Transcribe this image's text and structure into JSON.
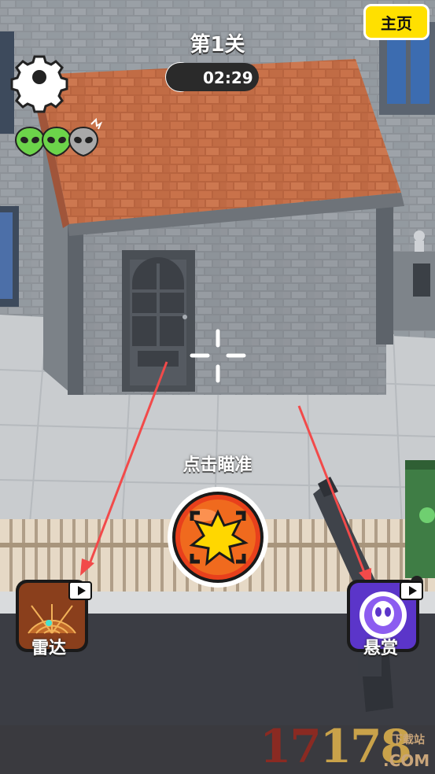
{
  "hud": {
    "level": "第1关",
    "timer": "02:29",
    "home_label": "主页",
    "aim_hint": "点击瞄准",
    "targets_remaining": 2,
    "targets_total": 3
  },
  "skills": [
    {
      "label": "雷达",
      "icon": "radar-icon"
    },
    {
      "label": "悬赏",
      "icon": "alien-bounty-icon"
    }
  ],
  "watermark": {
    "number_a": "17",
    "number_b": "178",
    "com": ".COM",
    "small": "下载站"
  },
  "colors": {
    "home_button": "#ffe000",
    "fire_button": "#e8401c",
    "alien_alive": "#6cd44a",
    "alien_dead": "#a9a9a9",
    "arrow": "#f24a4a"
  }
}
